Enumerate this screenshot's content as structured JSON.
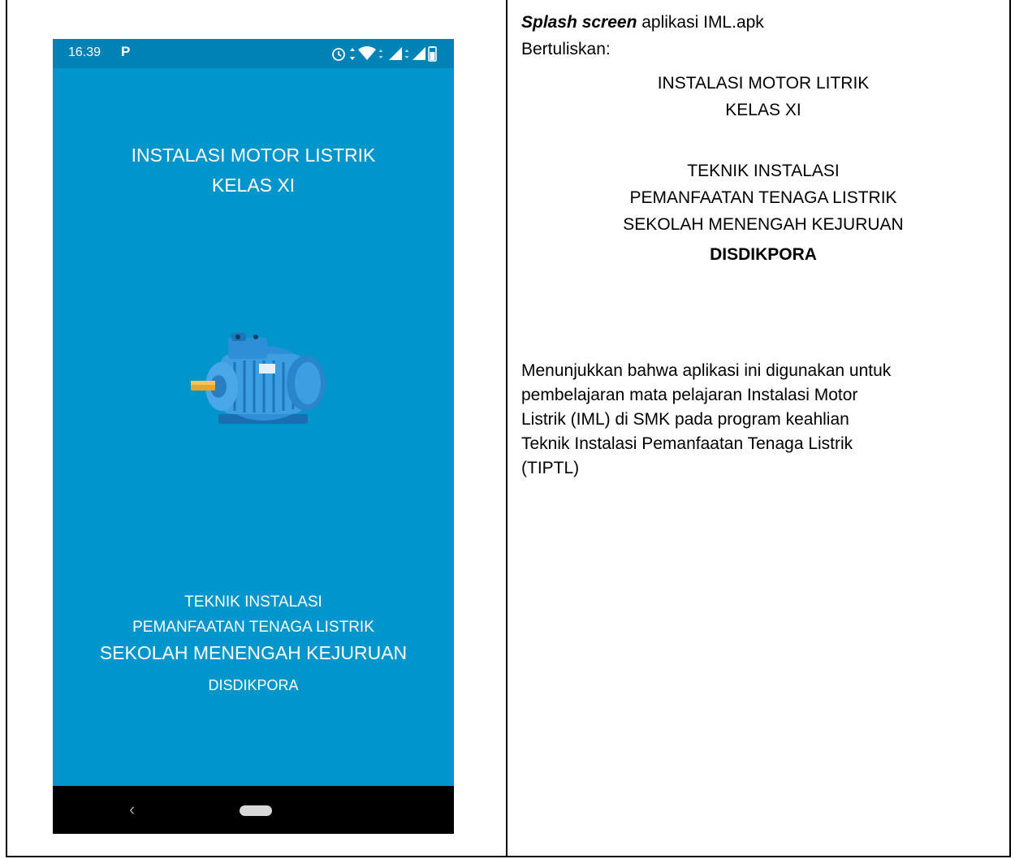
{
  "phone": {
    "status_time": "16.39",
    "status_app_icon": "P",
    "status_icons": [
      "alarm-icon",
      "data-arrows-icon",
      "wifi-icon",
      "signal-icon",
      "battery-icon"
    ],
    "title_line1": "INSTALASI MOTOR LISTRIK",
    "title_line2": "KELAS XI",
    "image": "electric-motor-icon",
    "footer_line1": "TEKNIK INSTALASI",
    "footer_line2": "PEMANFAATAN TENAGA LISTRIK",
    "footer_line3": "SEKOLAH MENENGAH KEJURUAN",
    "footer_line4": "DISDIKPORA",
    "nav_back": "‹",
    "background_color": "#0096cc",
    "statusbar_color": "#0082b5"
  },
  "description": {
    "title_bold": "Splash screen",
    "title_rest": " aplikasi IML.apk",
    "bertuliskan": "Bertuliskan:",
    "center_lines": [
      "INSTALASI MOTOR LITRIK",
      "KELAS XI",
      "TEKNIK INSTALASI",
      "PEMANFAATAN TENAGA LISTRIK",
      "SEKOLAH MENENGAH KEJURUAN"
    ],
    "center_bold": "DISDIKPORA",
    "paragraph_lines": [
      "Menunjukkan bahwa aplikasi ini digunakan untuk",
      "pembelajaran mata pelajaran Instalasi Motor",
      "Listrik (IML) di SMK pada program keahlian",
      "Teknik Instalasi Pemanfaatan Tenaga Listrik",
      "(TIPTL)"
    ]
  }
}
